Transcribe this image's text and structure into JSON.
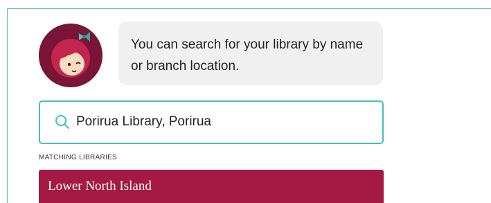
{
  "assistant": {
    "avatar_icon": "libby-avatar-icon",
    "message": "You can search for your library by name or branch location."
  },
  "search": {
    "icon": "search-icon",
    "value": "Porirua Library, Porirua"
  },
  "results": {
    "heading": "MATCHING LIBRARIES",
    "regions": [
      {
        "label": "Lower North Island"
      }
    ]
  },
  "colors": {
    "accent_teal": "#3fc1bd",
    "brand_maroon": "#a41a45",
    "avatar_background": "#7a1538",
    "bubble_background": "#f0f0f0"
  }
}
